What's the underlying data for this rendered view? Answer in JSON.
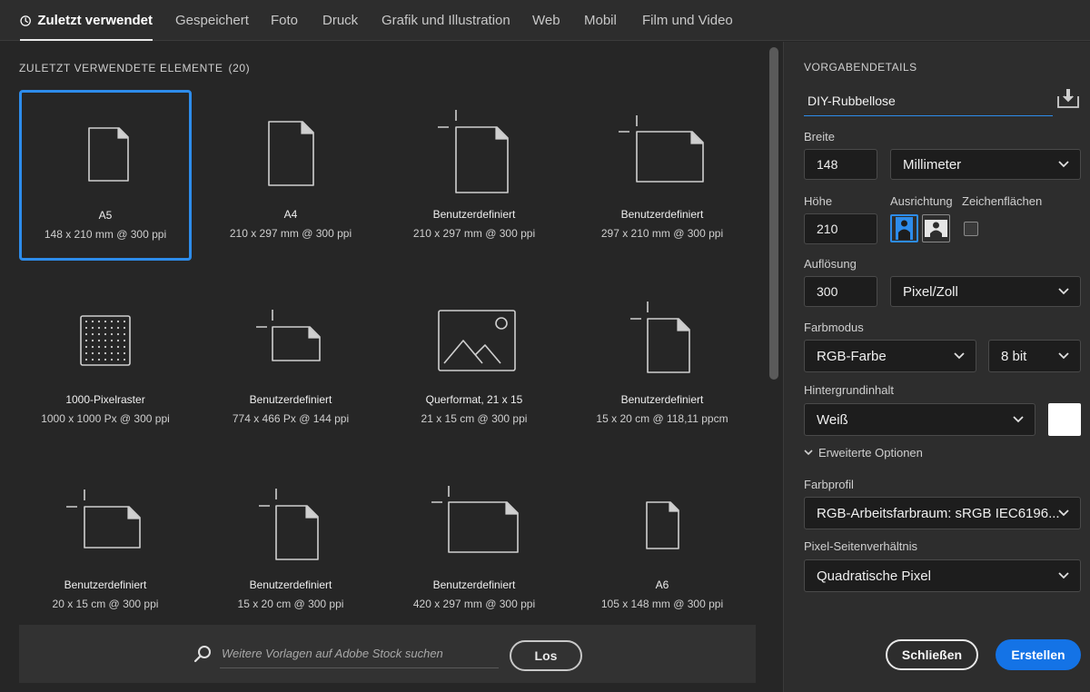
{
  "tabs": [
    {
      "label": "Zuletzt verwendet",
      "active": true
    },
    {
      "label": "Gespeichert"
    },
    {
      "label": "Foto"
    },
    {
      "label": "Druck"
    },
    {
      "label": "Grafik und Illustration"
    },
    {
      "label": "Web"
    },
    {
      "label": "Mobil"
    },
    {
      "label": "Film und Video"
    }
  ],
  "recent": {
    "title": "ZULETZT VERWENDETE ELEMENTE",
    "count": "(20)",
    "items": [
      {
        "name": "A5",
        "meta": "148 x 210 mm @ 300 ppi",
        "icon": "portrait-doc-icon",
        "selected": true
      },
      {
        "name": "A4",
        "meta": "210 x 297 mm @ 300 ppi",
        "icon": "portrait-doc-icon"
      },
      {
        "name": "Benutzerdefiniert",
        "meta": "210 x 297 mm @ 300 ppi",
        "icon": "custom-portrait-doc-icon"
      },
      {
        "name": "Benutzerdefiniert",
        "meta": "297 x 210 mm @ 300 ppi",
        "icon": "custom-landscape-doc-icon"
      },
      {
        "name": "1000-Pixelraster",
        "meta": "1000 x 1000 Px @ 300 ppi",
        "icon": "pixel-grid-icon"
      },
      {
        "name": "Benutzerdefiniert",
        "meta": "774 x 466 Px @ 144 ppi",
        "icon": "custom-landscape-doc-icon"
      },
      {
        "name": "Querformat, 21 x 15",
        "meta": "21 x 15 cm @ 300 ppi",
        "icon": "landscape-image-icon"
      },
      {
        "name": "Benutzerdefiniert",
        "meta": "15 x 20 cm @ 118,11 ppcm",
        "icon": "custom-portrait-doc-icon"
      },
      {
        "name": "Benutzerdefiniert",
        "meta": "20 x 15 cm @ 300 ppi",
        "icon": "custom-landscape-doc-icon"
      },
      {
        "name": "Benutzerdefiniert",
        "meta": "15 x 20 cm @ 300 ppi",
        "icon": "custom-portrait-doc-icon"
      },
      {
        "name": "Benutzerdefiniert",
        "meta": "420 x 297 mm @ 300 ppi",
        "icon": "custom-landscape-doc-icon"
      },
      {
        "name": "A6",
        "meta": "105 x 148 mm @ 300 ppi",
        "icon": "small-portrait-doc-icon"
      }
    ]
  },
  "search": {
    "placeholder": "Weitere Vorlagen auf Adobe Stock suchen",
    "button": "Los"
  },
  "panel": {
    "heading": "VORGABENDETAILS",
    "preset_name": "DIY-Rubbellose",
    "width_label": "Breite",
    "width_value": "148",
    "width_unit": "Millimeter",
    "height_label": "Höhe",
    "height_value": "210",
    "orientation_label": "Ausrichtung",
    "artboards_label": "Zeichenflächen",
    "resolution_label": "Auflösung",
    "resolution_value": "300",
    "resolution_unit": "Pixel/Zoll",
    "color_mode_label": "Farbmodus",
    "color_mode": "RGB-Farbe",
    "bit_depth": "8 bit",
    "background_label": "Hintergrundinhalt",
    "background": "Weiß",
    "background_color": "#ffffff",
    "advanced": "Erweiterte Optionen",
    "profile_label": "Farbprofil",
    "profile": "RGB-Arbeitsfarbraum: sRGB IEC6196...",
    "pixel_aspect_label": "Pixel-Seitenverhältnis",
    "pixel_aspect": "Quadratische Pixel",
    "close_button": "Schließen",
    "create_button": "Erstellen"
  },
  "colors": {
    "accent": "#2d8ceb",
    "primary_button": "#1473e6"
  }
}
